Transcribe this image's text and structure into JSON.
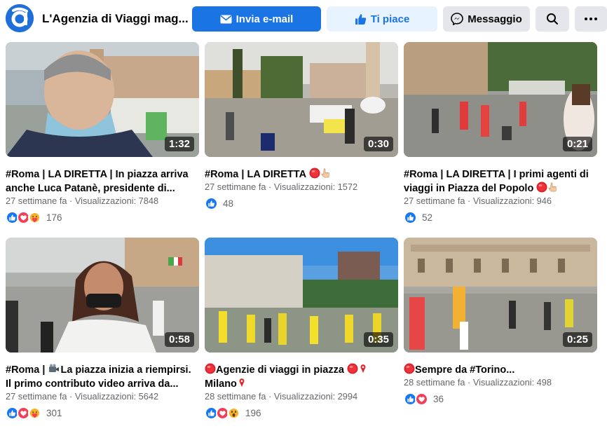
{
  "header": {
    "page_name": "L'Agenzia di Viaggi mag...",
    "email_label": "Invia e-mail",
    "like_label": "Ti piace",
    "message_label": "Messaggio"
  },
  "icons": [
    "agenzia-logo",
    "envelope-icon",
    "thumbs-up-icon",
    "messenger-icon",
    "search-icon",
    "more-icon",
    "red-circle-icon",
    "pointing-hand-icon",
    "video-camera-icon",
    "pin-icon"
  ],
  "colors": {
    "primary": "#1b74e4",
    "like_bg": "#e7f3ff",
    "gray_button": "#e4e6eb",
    "secondary_text": "#65676b",
    "love": "#f33e58",
    "care": "#f7b125"
  },
  "videos": [
    {
      "duration": "1:32",
      "title_1": "#Roma | LA DIRETTA | In piazza arriva",
      "title_2": "anche Luca Patanè, presidente di...",
      "meta": "27 settimane fa · Visualizzazioni: 7848",
      "reactions": [
        "like",
        "love",
        "care"
      ],
      "reaction_count": "176"
    },
    {
      "duration": "0:30",
      "title_1": "#Roma | LA DIRETTA",
      "meta": "27 settimane fa · Visualizzazioni: 1572",
      "reactions": [
        "like"
      ],
      "reaction_count": "48"
    },
    {
      "duration": "0:21",
      "title_1": "#Roma | LA DIRETTA | I primi agenti di",
      "title_2": "viaggi in Piazza del Popolo",
      "meta": "27 settimane fa · Visualizzazioni: 946",
      "reactions": [
        "like"
      ],
      "reaction_count": "52"
    },
    {
      "duration": "0:58",
      "title_1": "#Roma |",
      "title_1b": "La piazza inizia a riempirsi.",
      "title_2": "Il primo contributo video arriva da...",
      "meta": "27 settimane fa · Visualizzazioni: 5642",
      "reactions": [
        "like",
        "love",
        "care"
      ],
      "reaction_count": "301"
    },
    {
      "duration": "0:35",
      "title_1": "Agenzie di viaggi in piazza",
      "title_2": "Milano",
      "meta": "28 settimane fa · Visualizzazioni: 2994",
      "reactions": [
        "like",
        "love",
        "wow"
      ],
      "reaction_count": "196"
    },
    {
      "duration": "0:25",
      "title_1": "Sempre da #Torino...",
      "meta": "28 settimane fa · Visualizzazioni: 498",
      "reactions": [
        "like",
        "love"
      ],
      "reaction_count": "36"
    }
  ]
}
